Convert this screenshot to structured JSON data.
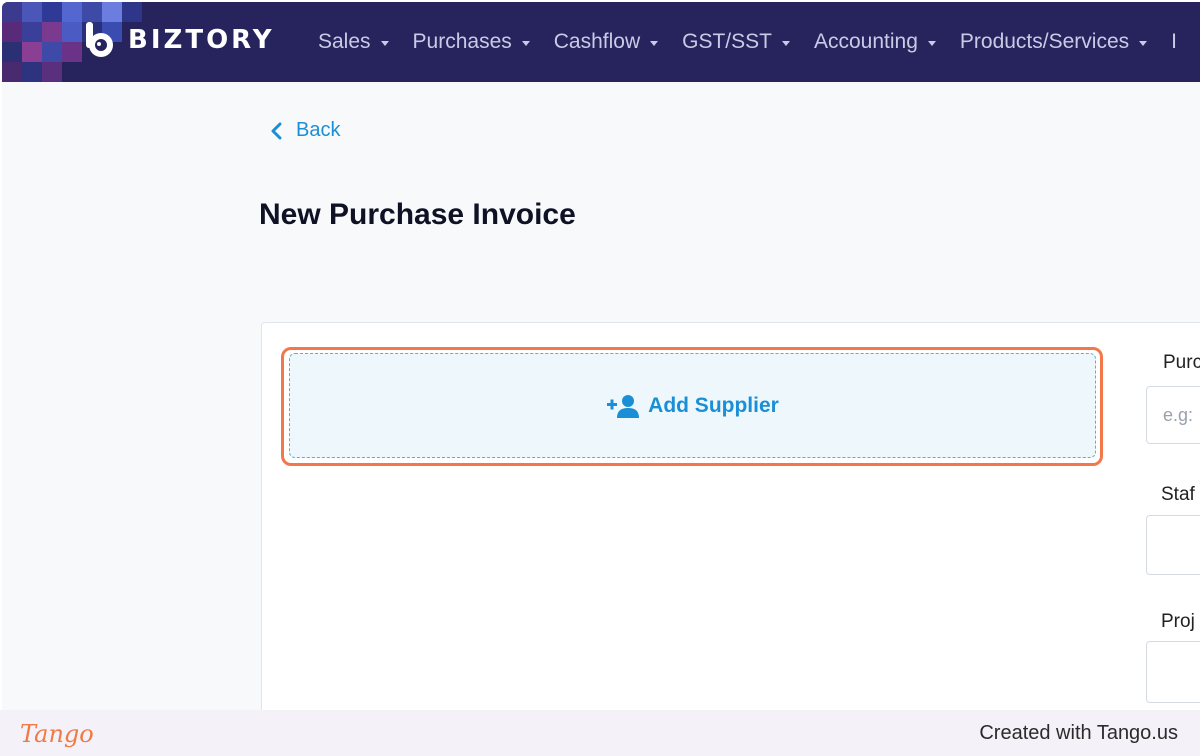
{
  "brand": {
    "name": "BIZTORY",
    "logo_icon": "biztory-logo-icon"
  },
  "nav": {
    "items": [
      {
        "label": "Sales"
      },
      {
        "label": "Purchases"
      },
      {
        "label": "Cashflow"
      },
      {
        "label": "GST/SST"
      },
      {
        "label": "Accounting"
      },
      {
        "label": "Products/Services"
      }
    ],
    "overflow_label": "I"
  },
  "back": {
    "label": "Back",
    "icon": "chevron-left-icon"
  },
  "page": {
    "title": "New Purchase Invoice"
  },
  "supplier": {
    "add_label": "Add Supplier",
    "icon": "add-user-icon"
  },
  "form": {
    "purchase_label": "Purc",
    "purchase_placeholder": "e.g:",
    "staff_label": "Staf",
    "project_label": "Proj"
  },
  "footer": {
    "logo_text": "Tango",
    "created_text": "Created with Tango.us"
  },
  "colors": {
    "navbar": "#27235c",
    "accent": "#1b8fd6",
    "highlight": "#f2784b",
    "tango": "#ef7a45"
  }
}
